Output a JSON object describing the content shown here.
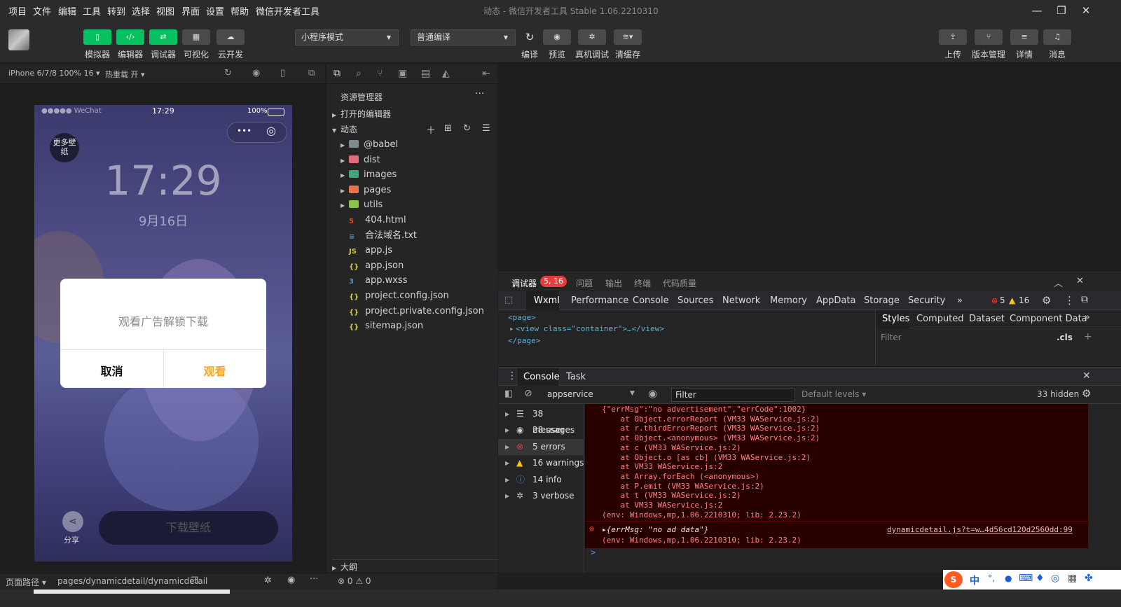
{
  "menubar": {
    "items": [
      "项目",
      "文件",
      "编辑",
      "工具",
      "转到",
      "选择",
      "视图",
      "界面",
      "设置",
      "帮助",
      "微信开发者工具"
    ],
    "title": "动态 - 微信开发者工具 Stable 1.06.2210310"
  },
  "toolbar": {
    "left_buttons": [
      {
        "label": "模拟器",
        "icon": "phone-icon"
      },
      {
        "label": "编辑器",
        "icon": "code-icon"
      },
      {
        "label": "调试器",
        "icon": "debug-toggle-icon"
      },
      {
        "label": "可视化",
        "icon": "layout-icon"
      },
      {
        "label": "云开发",
        "icon": "cloud-icon"
      }
    ],
    "mode_select": "小程序模式",
    "compile_select": "普通编译",
    "center_buttons": [
      {
        "label": "编译",
        "icon": "refresh-icon"
      },
      {
        "label": "预览",
        "icon": "eye-icon"
      },
      {
        "label": "真机调试",
        "icon": "bug-icon"
      },
      {
        "label": "清缓存",
        "icon": "layers-icon"
      }
    ],
    "right_buttons": [
      {
        "label": "上传",
        "icon": "upload-icon"
      },
      {
        "label": "版本管理",
        "icon": "branch-icon"
      },
      {
        "label": "详情",
        "icon": "menu-icon"
      },
      {
        "label": "消息",
        "icon": "bell-icon"
      }
    ]
  },
  "simulator": {
    "device": "iPhone 6/7/8 100% 16",
    "hot_reload": "热重载 开",
    "status_carrier": "●●●●● WeChat",
    "status_time": "17:29",
    "status_battery": "100%",
    "badge": "更多壁纸",
    "clock": "17:29",
    "date": "9月16日",
    "modal_text": "观看广告解锁下载",
    "modal_cancel": "取消",
    "modal_watch": "观看",
    "share_label": "分享",
    "download_label": "下载壁纸"
  },
  "explorer": {
    "title": "资源管理器",
    "open_editors": "打开的编辑器",
    "project": "动态",
    "outline": "大纲",
    "items": [
      {
        "name": "@babel",
        "type": "folder",
        "color": "#7f8c8d"
      },
      {
        "name": "dist",
        "type": "folder",
        "color": "#e06c75"
      },
      {
        "name": "images",
        "type": "folder",
        "color": "#3fa77a"
      },
      {
        "name": "pages",
        "type": "folder",
        "color": "#e8734a"
      },
      {
        "name": "utils",
        "type": "folder",
        "color": "#8bc34a"
      },
      {
        "name": "404.html",
        "type": "file",
        "icon": "5",
        "color": "#e44d26"
      },
      {
        "name": "合法域名.txt",
        "type": "file",
        "icon": "≡",
        "color": "#519aba"
      },
      {
        "name": "app.js",
        "type": "file",
        "icon": "JS",
        "color": "#cbcb41"
      },
      {
        "name": "app.json",
        "type": "file",
        "icon": "{}",
        "color": "#cbcb41"
      },
      {
        "name": "app.wxss",
        "type": "file",
        "icon": "3",
        "color": "#519aba"
      },
      {
        "name": "project.config.json",
        "type": "file",
        "icon": "{}",
        "color": "#cbcb41"
      },
      {
        "name": "project.private.config.json",
        "type": "file",
        "icon": "{}",
        "color": "#cbcb41"
      },
      {
        "name": "sitemap.json",
        "type": "file",
        "icon": "{}",
        "color": "#cbcb41"
      }
    ]
  },
  "debugger": {
    "tabs": [
      "调试器",
      "问题",
      "输出",
      "终端",
      "代码质量"
    ],
    "badge": "5, 16",
    "devtools_tabs": [
      "Wxml",
      "Performance",
      "Console",
      "Sources",
      "Network",
      "Memory",
      "AppData",
      "Storage",
      "Security"
    ],
    "more": "»",
    "errors_count": "5",
    "warnings_count": "16",
    "wxml_lines": [
      "<page>",
      "<view class=\"container\">…</view>",
      "</page>"
    ],
    "styles_tabs": [
      "Styles",
      "Computed",
      "Dataset",
      "Component Data"
    ],
    "styles_filter": "Filter",
    "styles_cls": ".cls",
    "console_tabs": [
      "Console",
      "Task"
    ],
    "context": "appservice",
    "filter_placeholder": "Filter",
    "levels": "Default levels",
    "hidden": "33 hidden",
    "sidebar": [
      {
        "label": "38 messages",
        "icon": "list-icon"
      },
      {
        "label": "28 user mes...",
        "icon": "user-icon"
      },
      {
        "label": "5 errors",
        "icon": "error-icon"
      },
      {
        "label": "16 warnings",
        "icon": "warning-icon"
      },
      {
        "label": "14 info",
        "icon": "info-icon"
      },
      {
        "label": "3 verbose",
        "icon": "verbose-icon"
      }
    ],
    "error_lines": [
      "{\"errMsg\":\"no advertisement\",\"errCode\":1002}",
      "    at Object.errorReport (VM33 WAService.js:2)",
      "    at r.thirdErrorReport (VM33 WAService.js:2)",
      "    at Object.<anonymous> (VM33 WAService.js:2)",
      "    at c (VM33 WAService.js:2)",
      "    at Object.o [as cb] (VM33 WAService.js:2)",
      "    at VM33 WAService.js:2",
      "    at Array.forEach (<anonymous>)",
      "    at P.emit (VM33 WAService.js:2)",
      "    at t (VM33 WAService.js:2)",
      "    at VM33 WAService.js:2",
      "(env: Windows,mp,1.06.2210310; lib: 2.23.2)"
    ],
    "error2": "▸{errMsg: \"no ad data\"}",
    "error2_env": "(env: Windows,mp,1.06.2210310; lib: 2.23.2)",
    "error2_link": "dynamicdetail.js?t=w…4d56cd120d2560dd:99",
    "prompt": ">"
  },
  "statusbar": {
    "path_label": "页面路径",
    "path": "pages/dynamicdetail/dynamicdetail",
    "problems": "0",
    "warnings": "0"
  },
  "ime": {
    "labels": [
      "中",
      "°,",
      "🎤",
      "⌨"
    ]
  }
}
